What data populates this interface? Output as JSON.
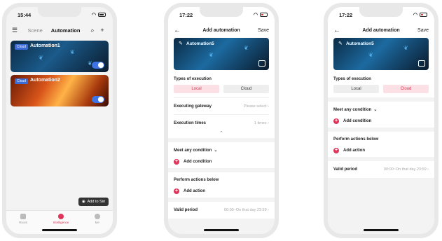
{
  "phone1": {
    "time": "15:44",
    "tabs": [
      "Scene",
      "Automation"
    ],
    "automations": [
      {
        "badge": "Cloud",
        "name": "Automation1"
      },
      {
        "badge": "Cloud",
        "name": "Automation2"
      }
    ],
    "siri_label": "Add to Siri",
    "tabbar": [
      "Room",
      "Intelligence",
      "Me"
    ]
  },
  "phone2": {
    "time": "17:22",
    "title": "Add automation",
    "save": "Save",
    "automation_name": "Automation5",
    "types_label": "Types of execution",
    "local": "Local",
    "cloud": "Cloud",
    "selected": "local",
    "gateway_label": "Executing gateway",
    "gateway_value": "Please select",
    "times_label": "Execution times",
    "times_value": "1 times",
    "condition_label": "Meet any condition",
    "add_condition": "Add condition",
    "actions_label": "Perform actions below",
    "add_action": "Add action",
    "valid_label": "Valid period",
    "valid_value": "00:00~On that day 23:59"
  },
  "phone3": {
    "time": "17:22",
    "title": "Add automation",
    "save": "Save",
    "automation_name": "Automation5",
    "types_label": "Types of execution",
    "local": "Local",
    "cloud": "Cloud",
    "selected": "cloud",
    "condition_label": "Meet any condition",
    "add_condition": "Add condition",
    "actions_label": "Perform actions below",
    "add_action": "Add action",
    "valid_label": "Valid period",
    "valid_value": "00:00~On that day 23:59"
  }
}
